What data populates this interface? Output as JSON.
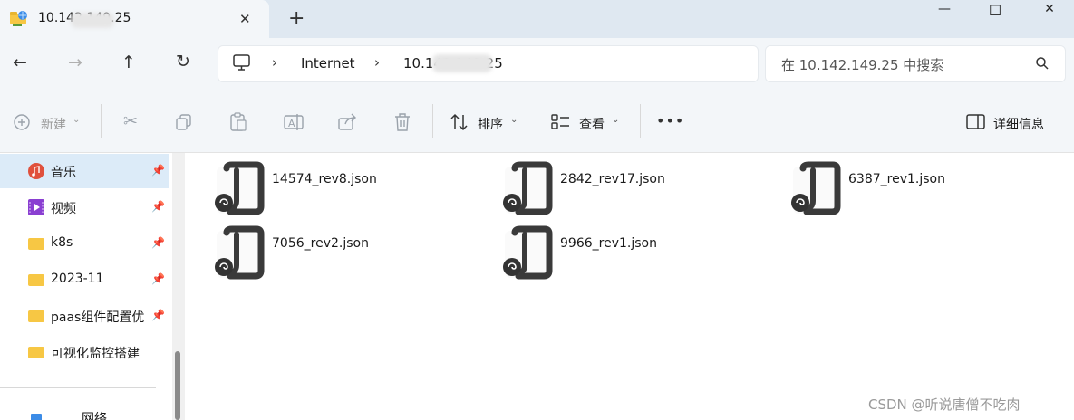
{
  "tab": {
    "title": "10.142.149.25",
    "icon": "network-folder-icon",
    "close": "✕",
    "new_tab": "+"
  },
  "window": {
    "minimize": "—",
    "maximize": "☐",
    "close": "✕"
  },
  "nav": {
    "back": "←",
    "forward": "→",
    "up": "↑",
    "refresh": "↻",
    "breadcrumb": [
      "Internet",
      "10.142.149.25"
    ],
    "search_placeholder": "在 10.142.149.25 中搜索"
  },
  "toolbar": {
    "new_label": "新建",
    "sort_label": "排序",
    "view_label": "查看",
    "more": "•••",
    "details_label": "详细信息"
  },
  "sidebar": {
    "items": [
      {
        "label": "音乐",
        "icon": "music-icon",
        "pinned": true,
        "selected": true
      },
      {
        "label": "视频",
        "icon": "video-icon",
        "pinned": true,
        "selected": false
      },
      {
        "label": "k8s",
        "icon": "folder-icon",
        "pinned": true,
        "selected": false
      },
      {
        "label": "2023-11",
        "icon": "folder-icon",
        "pinned": true,
        "selected": false
      },
      {
        "label": "paas组件配置优",
        "icon": "folder-icon",
        "pinned": true,
        "selected": false
      },
      {
        "label": "可视化监控搭建",
        "icon": "folder-icon",
        "pinned": false,
        "selected": false
      }
    ],
    "partial_item": "网络"
  },
  "files": [
    {
      "name": "14574_rev8.json"
    },
    {
      "name": "2842_rev17.json"
    },
    {
      "name": "6387_rev1.json"
    },
    {
      "name": "7056_rev2.json"
    },
    {
      "name": "9966_rev1.json"
    }
  ],
  "watermark": "CSDN @听说唐僧不吃肉"
}
